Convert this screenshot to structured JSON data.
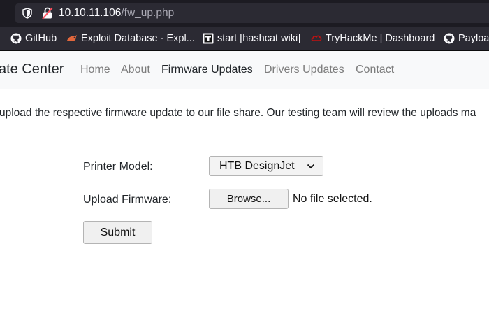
{
  "browser": {
    "url_host": "10.10.11.106",
    "url_path": "/fw_up.php",
    "bookmarks": [
      {
        "label": "GitHub",
        "icon": "github-icon"
      },
      {
        "label": "Exploit Database - Expl...",
        "icon": "exploit-db-icon"
      },
      {
        "label": "start [hashcat wiki]",
        "icon": "hashcat-icon"
      },
      {
        "label": "TryHackMe | Dashboard",
        "icon": "tryhackme-icon"
      },
      {
        "label": "Payloa",
        "icon": "github-icon"
      }
    ]
  },
  "navbar": {
    "brand": "ate Center",
    "links": [
      "Home",
      "About",
      "Firmware Updates",
      "Drivers Updates",
      "Contact"
    ],
    "active": "Firmware Updates"
  },
  "main": {
    "intro": "upload the respective firmware update to our file share. Our testing team will review the uploads ma",
    "form": {
      "printer_label": "Printer Model:",
      "printer_value": "HTB DesignJet",
      "upload_label": "Upload Firmware:",
      "browse_label": "Browse...",
      "file_status": "No file selected.",
      "submit_label": "Submit"
    }
  },
  "colors": {
    "browser_dark": "#1c1b22",
    "toolbar": "#2b2a33",
    "navbar_bg": "#f8f9fa",
    "nav_muted": "#7d7d7d",
    "text": "#212529"
  }
}
